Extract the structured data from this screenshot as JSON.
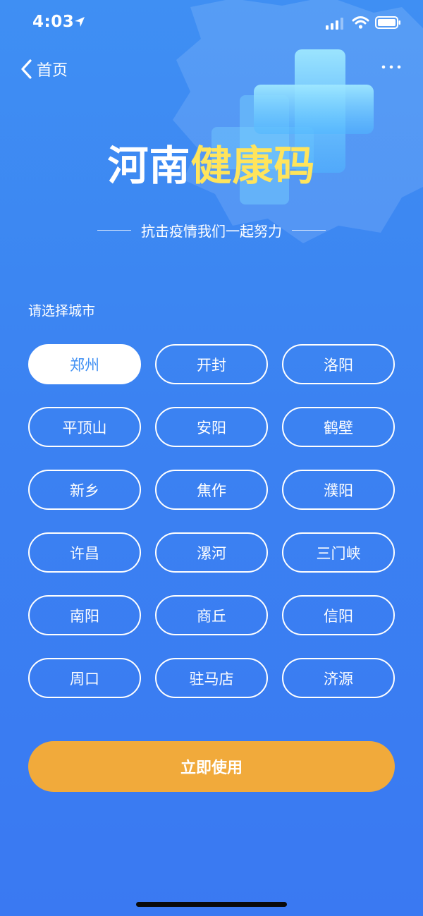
{
  "status_bar": {
    "time": "4:03"
  },
  "nav": {
    "back_label": "首页"
  },
  "header": {
    "title_part1": "河南",
    "title_part2": "健康码",
    "subtitle": "抗击疫情我们一起努力"
  },
  "prompt": "请选择城市",
  "cities": [
    "郑州",
    "开封",
    "洛阳",
    "平顶山",
    "安阳",
    "鹤壁",
    "新乡",
    "焦作",
    "濮阳",
    "许昌",
    "漯河",
    "三门峡",
    "南阳",
    "商丘",
    "信阳",
    "周口",
    "驻马店",
    "济源"
  ],
  "selected_city": "郑州",
  "action": {
    "use_label": "立即使用"
  },
  "colors": {
    "background": "#3f8ff3",
    "title_accent": "#ffe45c",
    "button_accent": "#f1aa3b"
  },
  "icons": [
    "location-arrow-icon",
    "signal-icon",
    "wifi-icon",
    "battery-icon",
    "back-chevron-icon",
    "more-icon"
  ]
}
